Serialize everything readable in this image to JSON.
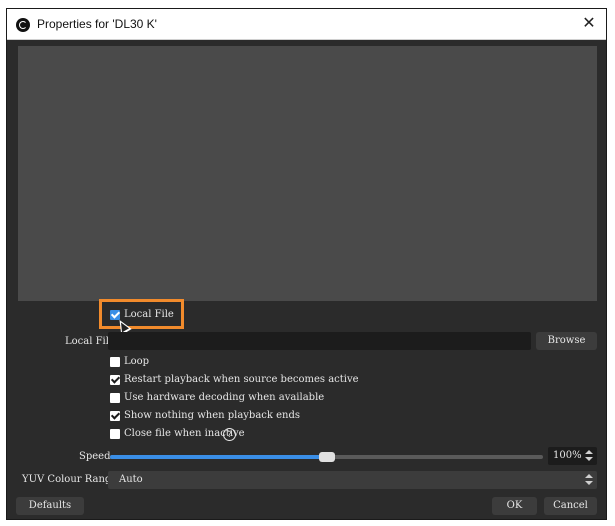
{
  "window": {
    "title": "Properties for 'DL30 K'",
    "close_glyph": "✕"
  },
  "local_file_toggle": {
    "label": "Local File",
    "checked": true
  },
  "local_file_field": {
    "label": "Local File",
    "value": "",
    "browse_label": "Browse"
  },
  "options": [
    {
      "label": "Loop",
      "checked": false
    },
    {
      "label": "Restart playback when source becomes active",
      "checked": true
    },
    {
      "label": "Use hardware decoding when available",
      "checked": false
    },
    {
      "label": "Show nothing when playback ends",
      "checked": true
    },
    {
      "label": "Close file when inactive",
      "checked": false
    }
  ],
  "speed": {
    "label": "Speed",
    "value": "100%",
    "level": 0.5
  },
  "yuv": {
    "label": "YUV Colour Range",
    "value": "Auto"
  },
  "buttons": {
    "defaults": "Defaults",
    "ok": "OK",
    "cancel": "Cancel"
  },
  "icons": [
    "obs-logo-icon",
    "close-icon",
    "help-icon",
    "spin-arrows-icon",
    "mouse-cursor-icon"
  ],
  "colors": {
    "accent": "#3a8ee6",
    "highlight": "#f28b2c",
    "background": "#2b2b2b",
    "preview": "#4a4a4a"
  }
}
